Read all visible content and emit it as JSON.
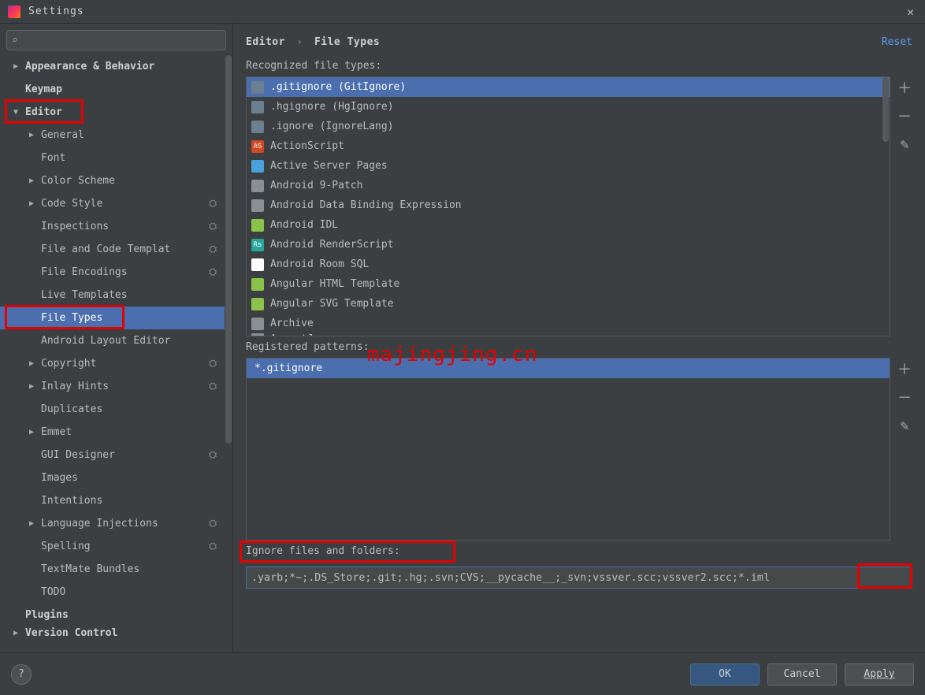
{
  "window": {
    "title": "Settings"
  },
  "search": {
    "placeholder": ""
  },
  "tree": [
    {
      "label": "Appearance & Behavior",
      "depth": 0,
      "arrow": "right",
      "bold": true
    },
    {
      "label": "Keymap",
      "depth": 0,
      "arrow": "",
      "bold": true
    },
    {
      "label": "Editor",
      "depth": 0,
      "arrow": "down",
      "bold": true,
      "boxed": true
    },
    {
      "label": "General",
      "depth": 1,
      "arrow": "right"
    },
    {
      "label": "Font",
      "depth": 1,
      "arrow": ""
    },
    {
      "label": "Color Scheme",
      "depth": 1,
      "arrow": "right"
    },
    {
      "label": "Code Style",
      "depth": 1,
      "arrow": "right",
      "gear": true
    },
    {
      "label": "Inspections",
      "depth": 1,
      "arrow": "",
      "gear": true
    },
    {
      "label": "File and Code Templates",
      "depth": 1,
      "arrow": "",
      "gear": true,
      "clip": true
    },
    {
      "label": "File Encodings",
      "depth": 1,
      "arrow": "",
      "gear": true
    },
    {
      "label": "Live Templates",
      "depth": 1,
      "arrow": ""
    },
    {
      "label": "File Types",
      "depth": 1,
      "arrow": "",
      "selected": true,
      "boxed": true
    },
    {
      "label": "Android Layout Editor",
      "depth": 1,
      "arrow": ""
    },
    {
      "label": "Copyright",
      "depth": 1,
      "arrow": "right",
      "gear": true
    },
    {
      "label": "Inlay Hints",
      "depth": 1,
      "arrow": "right",
      "gear": true
    },
    {
      "label": "Duplicates",
      "depth": 1,
      "arrow": ""
    },
    {
      "label": "Emmet",
      "depth": 1,
      "arrow": "right"
    },
    {
      "label": "GUI Designer",
      "depth": 1,
      "arrow": "",
      "gear": true
    },
    {
      "label": "Images",
      "depth": 1,
      "arrow": ""
    },
    {
      "label": "Intentions",
      "depth": 1,
      "arrow": ""
    },
    {
      "label": "Language Injections",
      "depth": 1,
      "arrow": "right",
      "gear": true
    },
    {
      "label": "Spelling",
      "depth": 1,
      "arrow": "",
      "gear": true
    },
    {
      "label": "TextMate Bundles",
      "depth": 1,
      "arrow": ""
    },
    {
      "label": "TODO",
      "depth": 1,
      "arrow": ""
    },
    {
      "label": "Plugins",
      "depth": 0,
      "arrow": "",
      "bold": true
    },
    {
      "label": "Version Control",
      "depth": 0,
      "arrow": "right",
      "bold": true,
      "cut": true
    }
  ],
  "breadcrumb": {
    "parent": "Editor",
    "current": "File Types"
  },
  "reset": "Reset",
  "labels": {
    "recognized": "Recognized file types:",
    "registered": "Registered patterns:",
    "ignore": "Ignore files and folders:"
  },
  "file_types": [
    {
      "label": ".gitignore (GitIgnore)",
      "icon_bg": "#6a7f8f",
      "selected": true
    },
    {
      "label": ".hgignore (HgIgnore)",
      "icon_bg": "#6a7f8f"
    },
    {
      "label": ".ignore (IgnoreLang)",
      "icon_bg": "#6a7f8f"
    },
    {
      "label": "ActionScript",
      "icon_bg": "#d24726",
      "icon_text": "AS"
    },
    {
      "label": "Active Server Pages",
      "icon_bg": "#4aa0d9"
    },
    {
      "label": "Android 9-Patch",
      "icon_bg": "#8a8f94"
    },
    {
      "label": "Android Data Binding Expression",
      "icon_bg": "#8a8f94"
    },
    {
      "label": "Android IDL",
      "icon_bg": "#8bc34a"
    },
    {
      "label": "Android RenderScript",
      "icon_bg": "#26a69a",
      "icon_text": "Rs"
    },
    {
      "label": "Android Room SQL",
      "icon_bg": "#ffffff"
    },
    {
      "label": "Angular HTML Template",
      "icon_bg": "#8bc34a"
    },
    {
      "label": "Angular SVG Template",
      "icon_bg": "#8bc34a"
    },
    {
      "label": "Archive",
      "icon_bg": "#8a8f94"
    },
    {
      "label": "AspectJ",
      "icon_bg": "#8a8f94",
      "cut": true
    }
  ],
  "patterns": [
    {
      "label": "*.gitignore",
      "selected": true
    }
  ],
  "ignore_value": ".yarb;*~;.DS_Store;.git;.hg;.svn;CVS;__pycache__;_svn;vssver.scc;vssver2.scc;*.iml",
  "buttons": {
    "ok": "OK",
    "cancel": "Cancel",
    "apply": "Apply"
  },
  "watermark": "majingjing.cn"
}
